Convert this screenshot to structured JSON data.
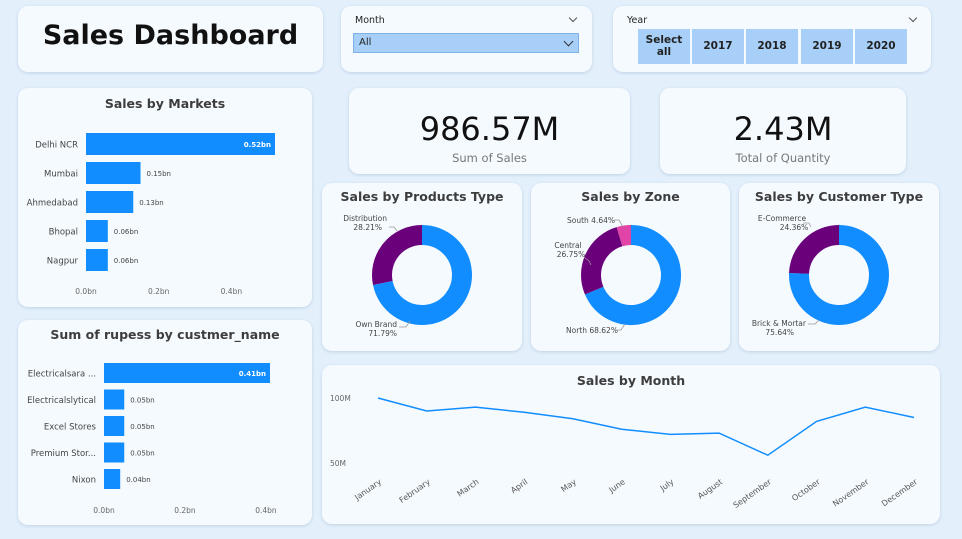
{
  "header": {
    "title": "Sales Dashboard"
  },
  "month_slicer": {
    "label": "Month",
    "selected": "All"
  },
  "year_slicer": {
    "label": "Year",
    "buttons": [
      "Select all",
      "2017",
      "2018",
      "2019",
      "2020"
    ]
  },
  "kpis": [
    {
      "value": "986.57M",
      "label": "Sum of Sales"
    },
    {
      "value": "2.43M",
      "label": "Total of Quantity"
    }
  ],
  "colors": {
    "bar": "#118dff",
    "purple": "#6b007b",
    "pink": "#e044a7",
    "line": "#118dff",
    "card": "#f5faff",
    "background": "#e3f0fc"
  },
  "chart_data": [
    {
      "id": "markets",
      "type": "bar",
      "orientation": "horizontal",
      "title": "Sales by Markets",
      "categories": [
        "Delhi NCR",
        "Mumbai",
        "Ahmedabad",
        "Bhopal",
        "Nagpur"
      ],
      "values": [
        0.52,
        0.15,
        0.13,
        0.06,
        0.06
      ],
      "data_labels": [
        "0.52bn",
        "0.15bn",
        "0.13bn",
        "0.06bn",
        "0.06bn"
      ],
      "x_ticks": [
        "0.0bn",
        "0.2bn",
        "0.4bn"
      ],
      "xlim": [
        0,
        0.52
      ]
    },
    {
      "id": "customers",
      "type": "bar",
      "orientation": "horizontal",
      "title": "Sum of rupess by custmer_name",
      "categories": [
        "Electricalsara ...",
        "Electricalslytical",
        "Excel Stores",
        "Premium Stor...",
        "Nixon"
      ],
      "values": [
        0.41,
        0.05,
        0.05,
        0.05,
        0.04
      ],
      "data_labels": [
        "0.41bn",
        "0.05bn",
        "0.05bn",
        "0.05bn",
        "0.04bn"
      ],
      "x_ticks": [
        "0.0bn",
        "0.2bn",
        "0.4bn"
      ],
      "xlim": [
        0,
        0.41
      ]
    },
    {
      "id": "products",
      "type": "pie",
      "donut": true,
      "title": "Sales by Products Type",
      "slices": [
        {
          "name": "Own Brand",
          "value": 71.79,
          "label": "Own Brand",
          "pct": "71.79%",
          "color": "#118dff"
        },
        {
          "name": "Distribution",
          "value": 28.21,
          "label": "Distribution",
          "pct": "28.21%",
          "color": "#6b007b"
        }
      ]
    },
    {
      "id": "zone",
      "type": "pie",
      "donut": true,
      "title": "Sales by Zone",
      "slices": [
        {
          "name": "North",
          "value": 68.62,
          "label": "North 68.62%",
          "color": "#118dff"
        },
        {
          "name": "Central",
          "value": 26.75,
          "label": "Central",
          "pct": "26.75%",
          "color": "#6b007b"
        },
        {
          "name": "South",
          "value": 4.64,
          "label": "South 4.64%",
          "color": "#e044a7"
        }
      ]
    },
    {
      "id": "customer_type",
      "type": "pie",
      "donut": true,
      "title": "Sales by Customer Type",
      "slices": [
        {
          "name": "Brick & Mortar",
          "value": 75.64,
          "label": "Brick & Mortar",
          "pct": "75.64%",
          "color": "#118dff"
        },
        {
          "name": "E-Commerce",
          "value": 24.36,
          "label": "E-Commerce",
          "pct": "24.36%",
          "color": "#6b007b"
        }
      ]
    },
    {
      "id": "month",
      "type": "line",
      "title": "Sales by Month",
      "categories": [
        "January",
        "February",
        "March",
        "April",
        "May",
        "June",
        "July",
        "August",
        "September",
        "October",
        "November",
        "December"
      ],
      "values": [
        100,
        90,
        93,
        89,
        84,
        76,
        72,
        73,
        56,
        82,
        93,
        85
      ],
      "y_ticks": [
        {
          "label": "100M",
          "value": 100
        },
        {
          "label": "50M",
          "value": 50
        }
      ],
      "ylim": [
        50,
        100
      ]
    }
  ]
}
